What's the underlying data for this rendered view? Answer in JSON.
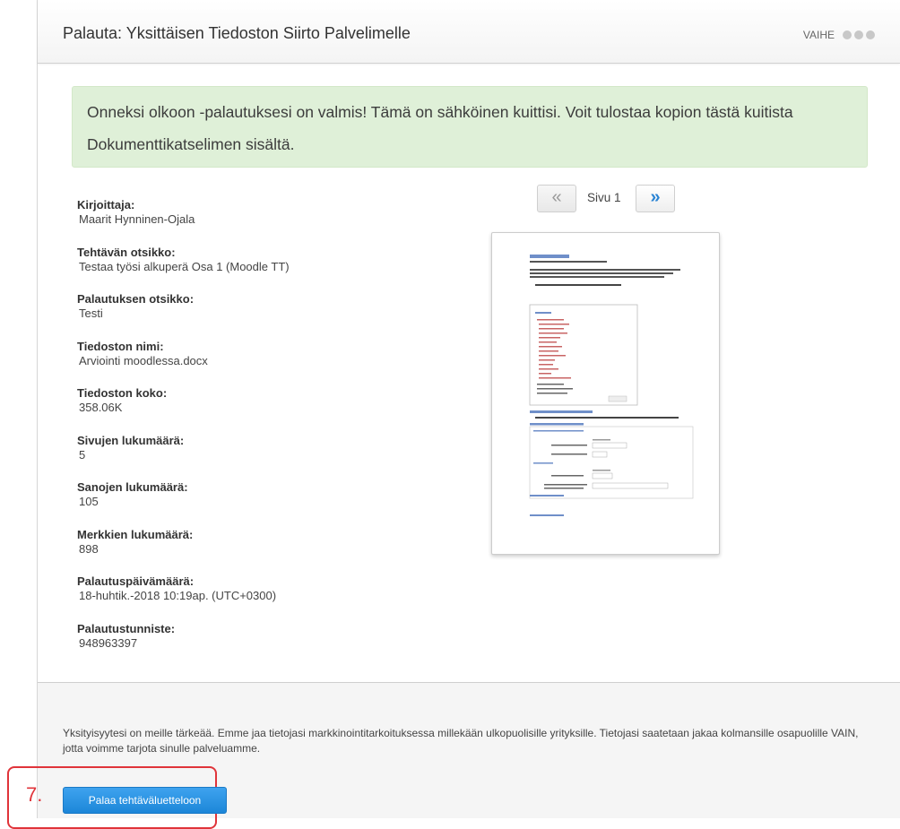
{
  "header": {
    "title": "Palauta: Yksittäisen Tiedoston Siirto Palvelimelle",
    "step_label": "VAIHE"
  },
  "success_message": "Onneksi olkoon -palautuksesi on valmis! Tämä on sähköinen kuittisi. Voit tulostaa kopion tästä kuitista Dokumenttikatselimen sisältä.",
  "meta": [
    {
      "label": "Kirjoittaja:",
      "value": "Maarit Hynninen-Ojala"
    },
    {
      "label": "Tehtävän otsikko:",
      "value": "Testaa työsi alkuperä Osa 1 (Moodle TT)"
    },
    {
      "label": "Palautuksen otsikko:",
      "value": "Testi"
    },
    {
      "label": "Tiedoston nimi:",
      "value": "Arviointi moodlessa.docx"
    },
    {
      "label": "Tiedoston koko:",
      "value": "358.06K"
    },
    {
      "label": "Sivujen lukumäärä:",
      "value": "5"
    },
    {
      "label": "Sanojen lukumäärä:",
      "value": "105"
    },
    {
      "label": "Merkkien lukumäärä:",
      "value": "898"
    },
    {
      "label": "Palautuspäivämäärä:",
      "value": "18-huhtik.-2018 10:19ap. (UTC+0300)"
    },
    {
      "label": "Palautustunniste:",
      "value": "948963397"
    }
  ],
  "viewer": {
    "prev_glyph": "«",
    "next_glyph": "»",
    "page_label": "Sivu 1"
  },
  "footer": {
    "privacy_text": "Yksityisyytesi on meille tärkeää. Emme jaa tietojasi markkinointitarkoituksessa millekään ulkopuolisille yrityksille. Tietojasi saatetaan jakaa kolmansille osapuolille VAIN, jotta voimme tarjota sinulle palveluamme.",
    "return_button": "Palaa tehtäväluetteloon",
    "annotation_number": "7."
  },
  "colors": {
    "success_bg": "#dff0d8",
    "primary_button": "#1c86d8",
    "annotation": "#e0343a"
  }
}
